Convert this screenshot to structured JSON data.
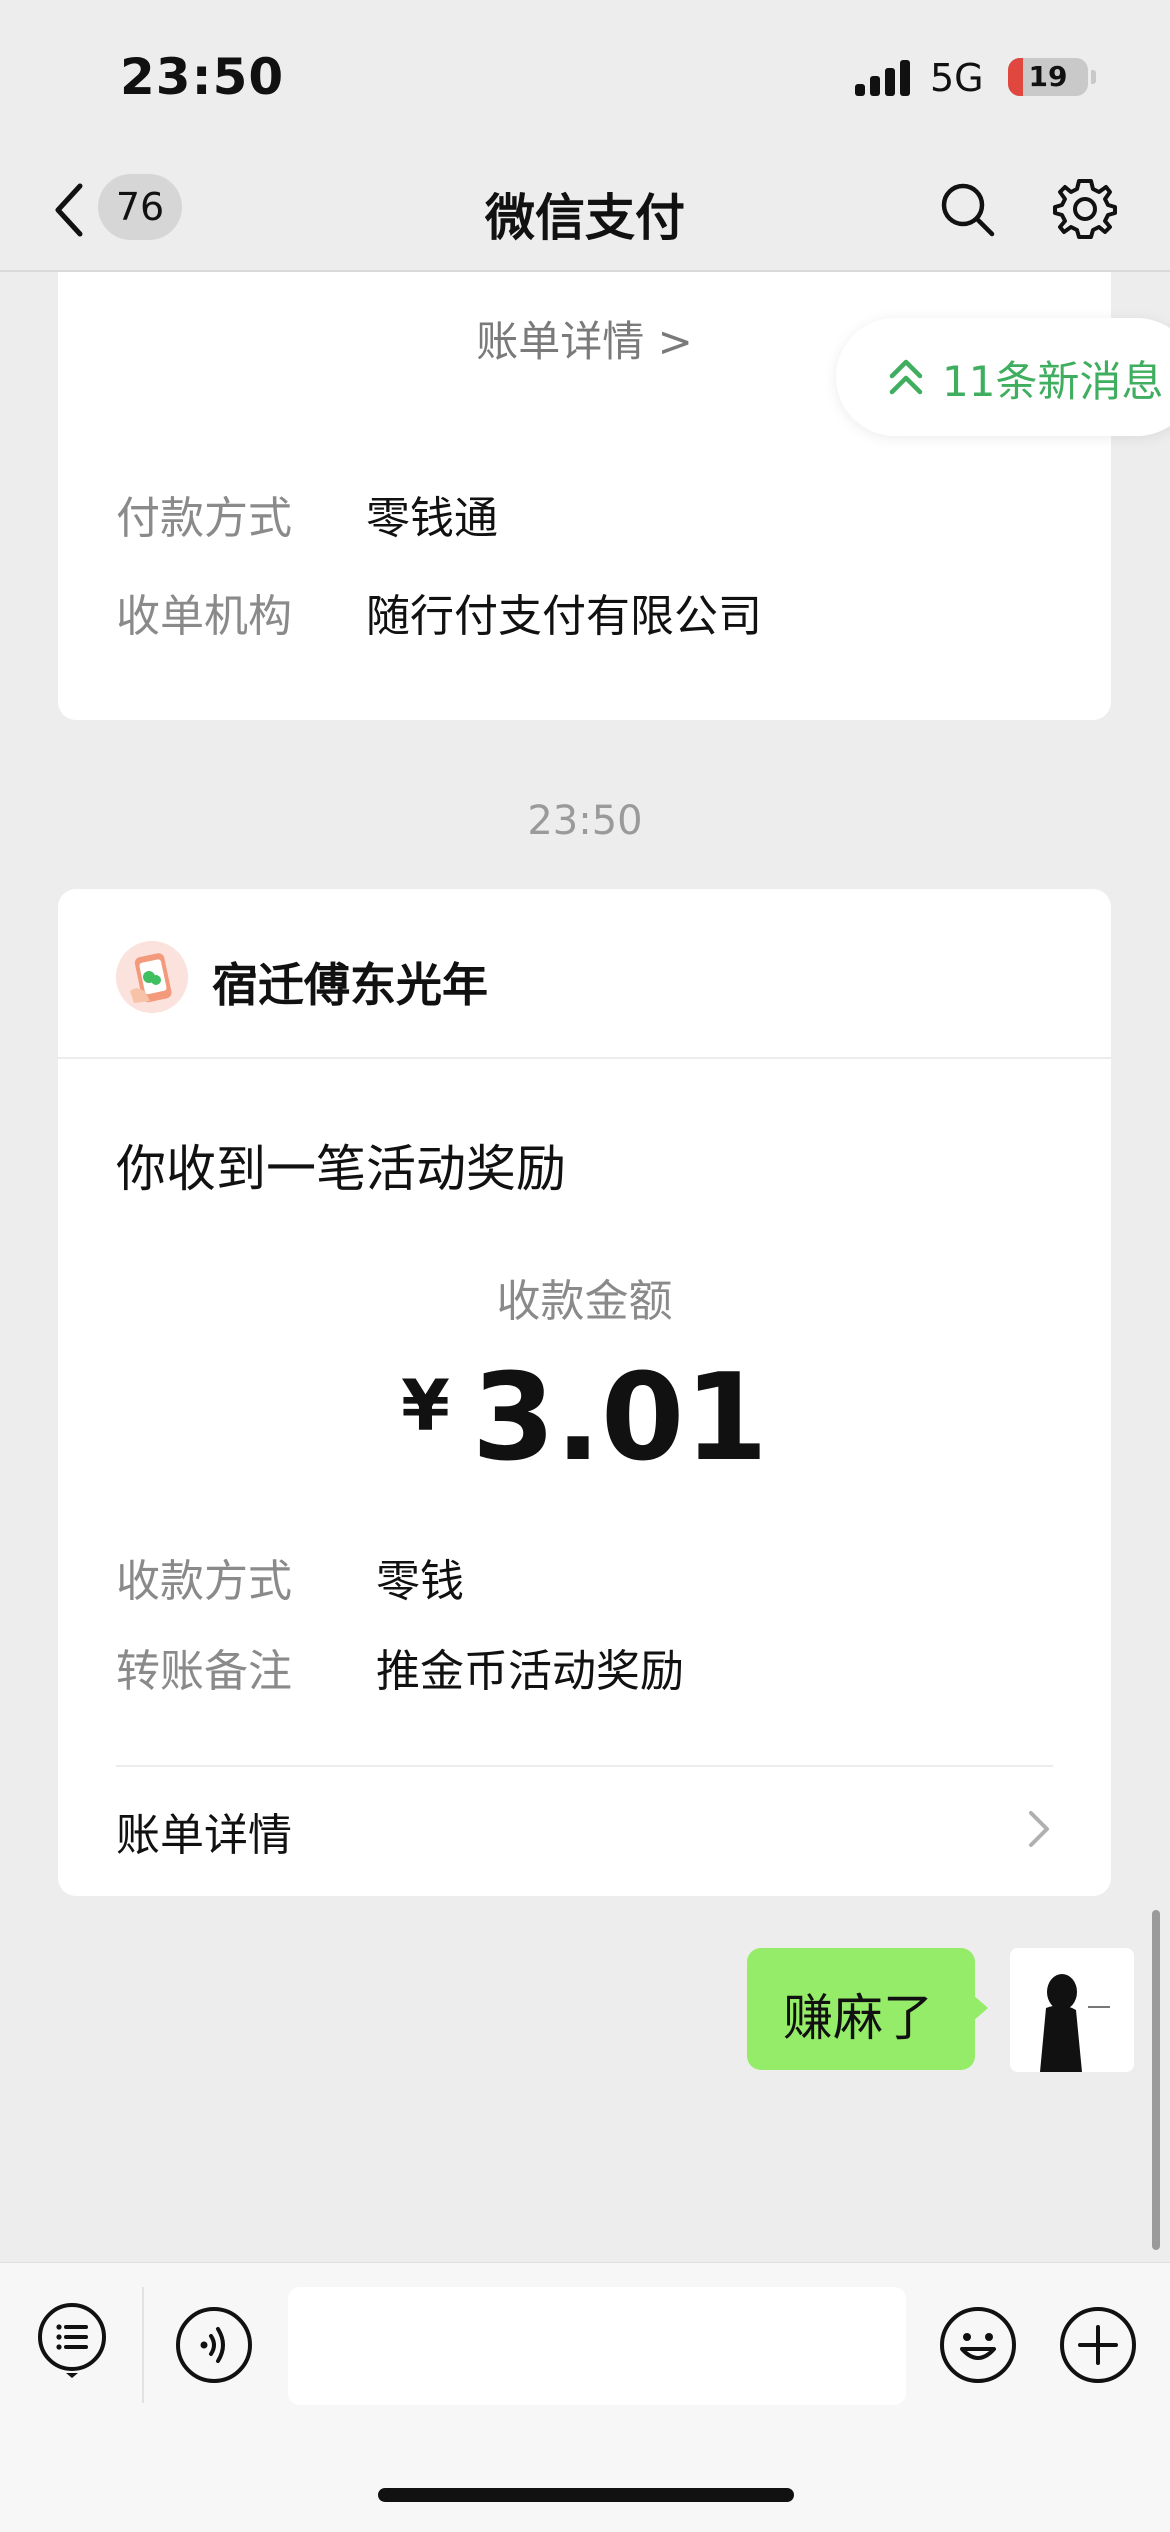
{
  "status_bar": {
    "time": "23:50",
    "network": "5G",
    "battery": "19",
    "battery_level": 0.19
  },
  "nav": {
    "badge_count": "76",
    "title": "微信支付"
  },
  "new_messages": {
    "text": "11条新消息"
  },
  "top_card": {
    "bill_link": "账单详情 >",
    "rows": [
      {
        "label": "付款方式",
        "value": "零钱通"
      },
      {
        "label": "收单机构",
        "value": "随行付支付有限公司"
      }
    ]
  },
  "timestamp": "23:50",
  "main_card": {
    "merchant": "宿迁傅东光年",
    "title": "你收到一笔活动奖励",
    "amount_label": "收款金额",
    "currency": "¥",
    "amount": "3.01",
    "rows": [
      {
        "label": "收款方式",
        "value": "零钱"
      },
      {
        "label": "转账备注",
        "value": "推金币活动奖励"
      }
    ],
    "bill_link": "账单详情"
  },
  "chat": {
    "sent_message": "赚麻了"
  },
  "colors": {
    "accent_green": "#3fae5f",
    "bubble_green": "#95ec69",
    "battery_low": "#e0473f"
  }
}
